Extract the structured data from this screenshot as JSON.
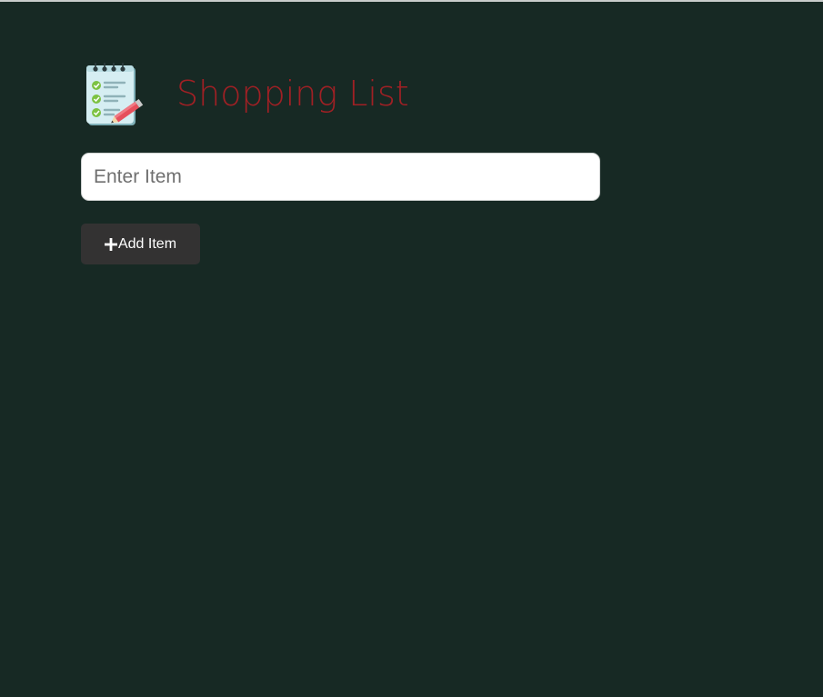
{
  "app": {
    "title": "Shopping List",
    "logo_icon": "notepad-checklist-pencil-icon"
  },
  "form": {
    "input_value": "",
    "input_placeholder": "Enter Item",
    "add_button_label": "Add Item",
    "add_button_icon": "plus-icon"
  },
  "colors": {
    "background": "#172924",
    "title": "#a02024",
    "button_bg": "#333232",
    "button_text": "#ffffff"
  },
  "items": []
}
